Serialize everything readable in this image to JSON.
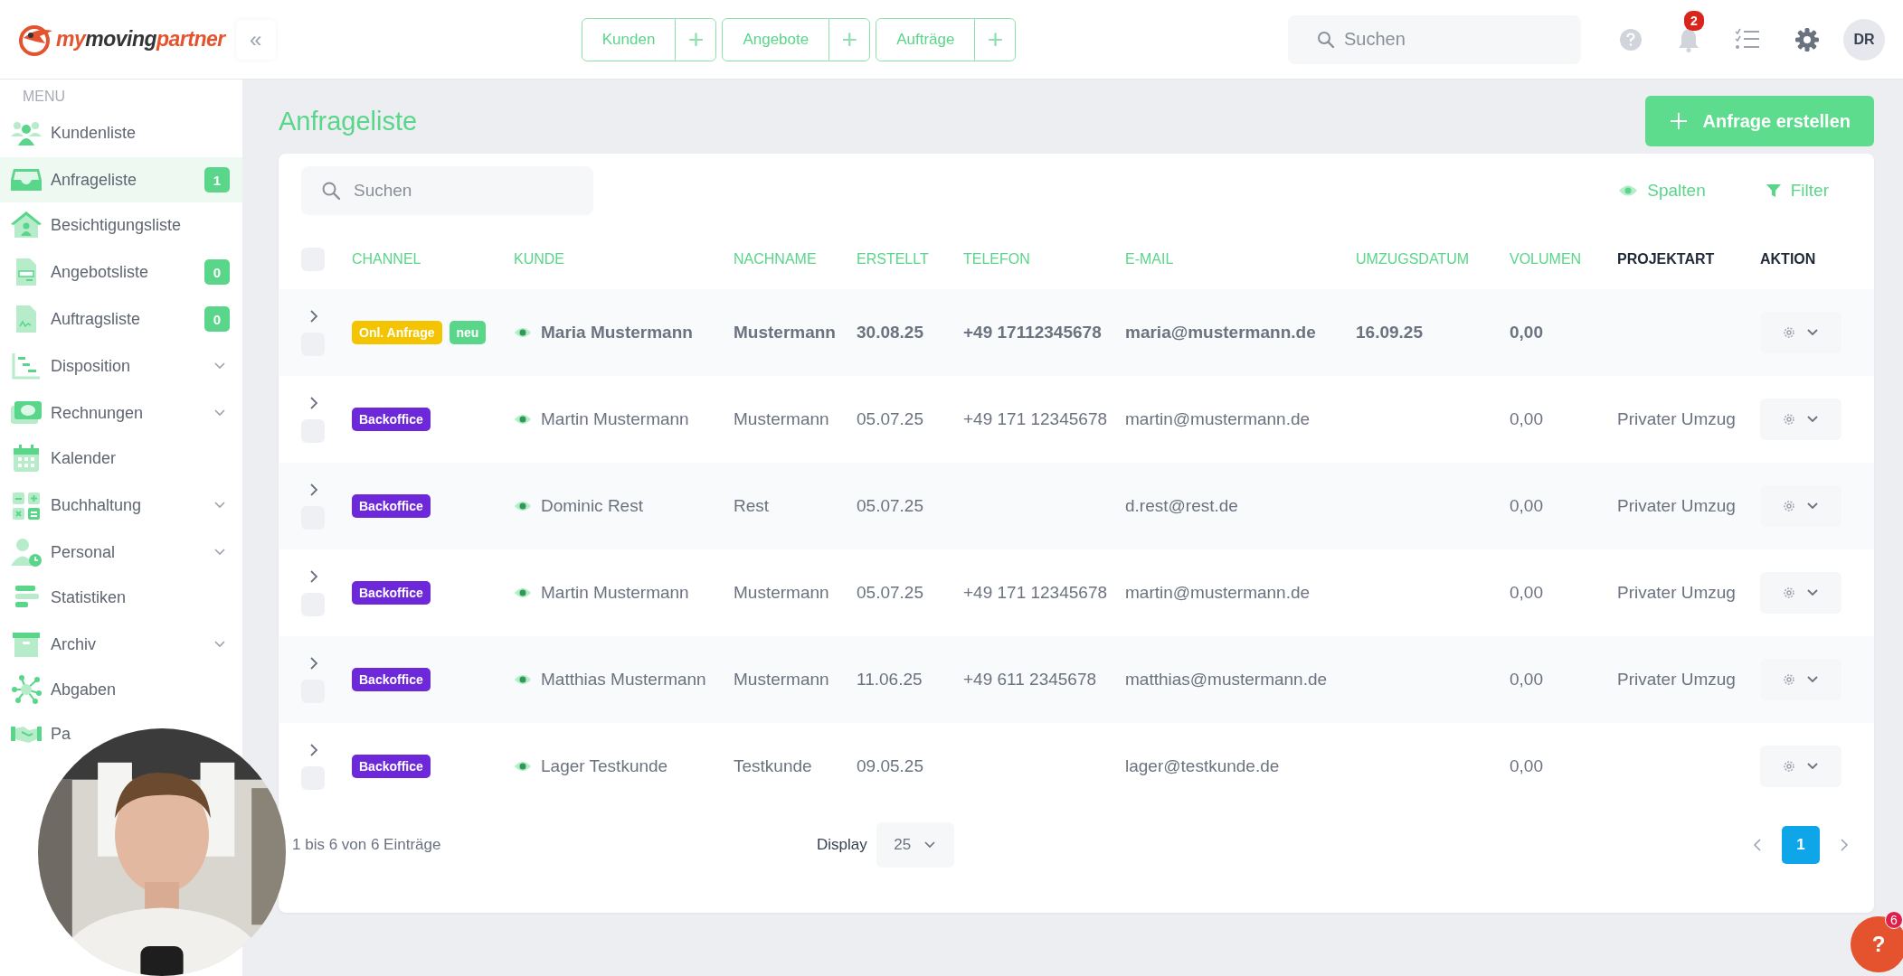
{
  "logo": {
    "segments": [
      {
        "text": "my",
        "color": "#e4532d"
      },
      {
        "text": "moving",
        "color": "#343434"
      },
      {
        "text": "partner",
        "color": "#e4532d"
      }
    ]
  },
  "collapse_button": "«",
  "quick_actions": [
    {
      "label": "Kunden",
      "plus": "+"
    },
    {
      "label": "Angebote",
      "plus": "+"
    },
    {
      "label": "Aufträge",
      "plus": "+"
    }
  ],
  "top_search": {
    "placeholder": "Suchen"
  },
  "notifications": {
    "count": "2"
  },
  "avatar": {
    "initials": "DR"
  },
  "sidebar": {
    "heading": "MENU",
    "items": [
      {
        "label": "Kundenliste",
        "selected": false,
        "expandable": false
      },
      {
        "label": "Anfrageliste",
        "selected": true,
        "expandable": false,
        "badge": "1"
      },
      {
        "label": "Besichtigungsliste",
        "selected": false,
        "expandable": false
      },
      {
        "label": "Angebotsliste",
        "selected": false,
        "expandable": false,
        "badge": "0"
      },
      {
        "label": "Auftragsliste",
        "selected": false,
        "expandable": false,
        "badge": "0"
      },
      {
        "label": "Disposition",
        "selected": false,
        "expandable": true
      },
      {
        "label": "Rechnungen",
        "selected": false,
        "expandable": true
      },
      {
        "label": "Kalender",
        "selected": false,
        "expandable": false
      },
      {
        "label": "Buchhaltung",
        "selected": false,
        "expandable": true
      },
      {
        "label": "Personal",
        "selected": false,
        "expandable": true
      },
      {
        "label": "Statistiken",
        "selected": false,
        "expandable": false
      },
      {
        "label": "Archiv",
        "selected": false,
        "expandable": true
      },
      {
        "label": "Abgaben",
        "selected": false,
        "expandable": false
      },
      {
        "label": "Pa",
        "selected": false,
        "expandable": false
      }
    ]
  },
  "page_title": "Anfrageliste",
  "create_button": {
    "label": "Anfrage erstellen"
  },
  "table_search": {
    "placeholder": "Suchen"
  },
  "columns_button": "Spalten",
  "filter_button": "Filter",
  "select_all": {
    "checked": false
  },
  "table": {
    "columns": [
      {
        "label": "CHANNEL",
        "sortable": true
      },
      {
        "label": "KUNDE",
        "sortable": true
      },
      {
        "label": "NACHNAME",
        "sortable": true
      },
      {
        "label": "ERSTELLT",
        "sortable": true
      },
      {
        "label": "TELEFON",
        "sortable": true
      },
      {
        "label": "E-MAIL",
        "sortable": true
      },
      {
        "label": "UMZUGSDATUM",
        "sortable": true
      },
      {
        "label": "VOLUMEN",
        "sortable": true
      },
      {
        "label": "PROJEKTART",
        "sortable": false
      },
      {
        "label": "AKTION",
        "sortable": false
      }
    ],
    "rows": [
      {
        "checked": false,
        "unread": true,
        "channel": {
          "label": "Onl. Anfrage",
          "color": "#f5c400"
        },
        "new_badge": "neu",
        "customer": "Maria Mustermann",
        "last_name": "Mustermann",
        "created": "30.08.25",
        "phone": "+49 17112345678",
        "email": "maria@mustermann.de",
        "move_date": "16.09.25",
        "volume": "0,00"
      },
      {
        "checked": false,
        "unread": false,
        "channel": {
          "label": "Backoffice",
          "color": "#6d28d9"
        },
        "customer": "Martin Mustermann",
        "last_name": "Mustermann",
        "created": "05.07.25",
        "phone": "+49 171 12345678",
        "email": "martin@mustermann.de",
        "volume": "0,00",
        "project_type": "Privater Umzug"
      },
      {
        "checked": false,
        "unread": false,
        "channel": {
          "label": "Backoffice",
          "color": "#6d28d9"
        },
        "customer": "Dominic Rest",
        "last_name": "Rest",
        "created": "05.07.25",
        "email": "d.rest@rest.de",
        "volume": "0,00",
        "project_type": "Privater Umzug"
      },
      {
        "checked": false,
        "unread": false,
        "channel": {
          "label": "Backoffice",
          "color": "#6d28d9"
        },
        "customer": "Martin Mustermann",
        "last_name": "Mustermann",
        "created": "05.07.25",
        "phone": "+49 171 12345678",
        "email": "martin@mustermann.de",
        "volume": "0,00",
        "project_type": "Privater Umzug"
      },
      {
        "checked": false,
        "unread": false,
        "channel": {
          "label": "Backoffice",
          "color": "#6d28d9"
        },
        "customer": "Matthias Mustermann",
        "last_name": "Mustermann",
        "created": "11.06.25",
        "phone": "+49 611 2345678",
        "email": "matthias@mustermann.de",
        "volume": "0,00",
        "project_type": "Privater Umzug"
      },
      {
        "checked": false,
        "unread": false,
        "channel": {
          "label": "Backoffice",
          "color": "#6d28d9"
        },
        "customer": "Lager Testkunde",
        "last_name": "Testkunde",
        "created": "09.05.25",
        "email": "lager@testkunde.de",
        "volume": "0,00"
      }
    ]
  },
  "footer": {
    "summary": "1 bis 6 von 6 Einträge",
    "display_label": "Display",
    "page_size": "25",
    "pages": [
      {
        "label": "1",
        "selected": true
      }
    ]
  },
  "help_button": {
    "label": "?",
    "count": "6"
  }
}
